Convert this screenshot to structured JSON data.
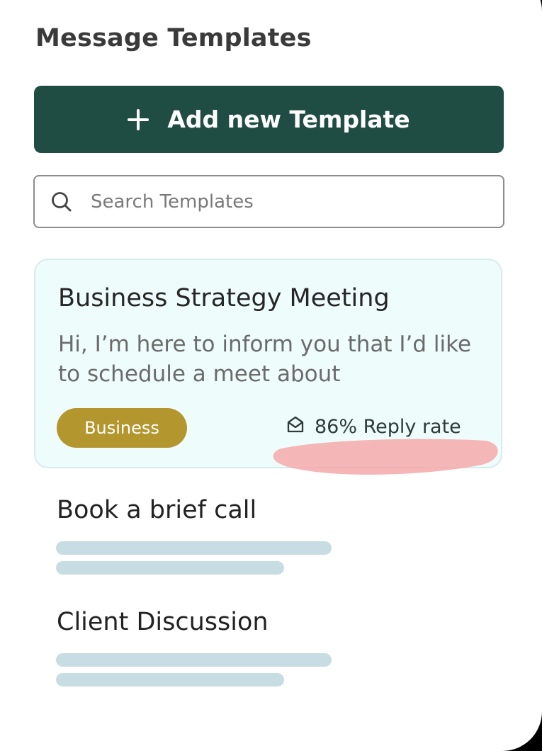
{
  "header": {
    "title": "Message Templates"
  },
  "add_button": {
    "label": "Add new Template",
    "icon": "plus-icon"
  },
  "search": {
    "placeholder": "Search Templates",
    "value": "",
    "icon": "search-icon"
  },
  "templates": [
    {
      "title": "Business Strategy Meeting",
      "preview": "Hi, I’m here to inform you that I’d like to schedule a meet about",
      "tag": "Business",
      "reply_rate": "86% Reply rate",
      "reply_icon": "envelope-open-icon",
      "highlighted": true
    },
    {
      "title": "Book a brief call",
      "preview_loading": true
    },
    {
      "title": "Client Discussion",
      "preview_loading": true
    }
  ],
  "colors": {
    "primary": "#1f4d43",
    "tag": "#b3962e",
    "card_bg": "#eefcfb",
    "skeleton": "#c7dde3",
    "highlight_mark": "#f4a9aa"
  }
}
